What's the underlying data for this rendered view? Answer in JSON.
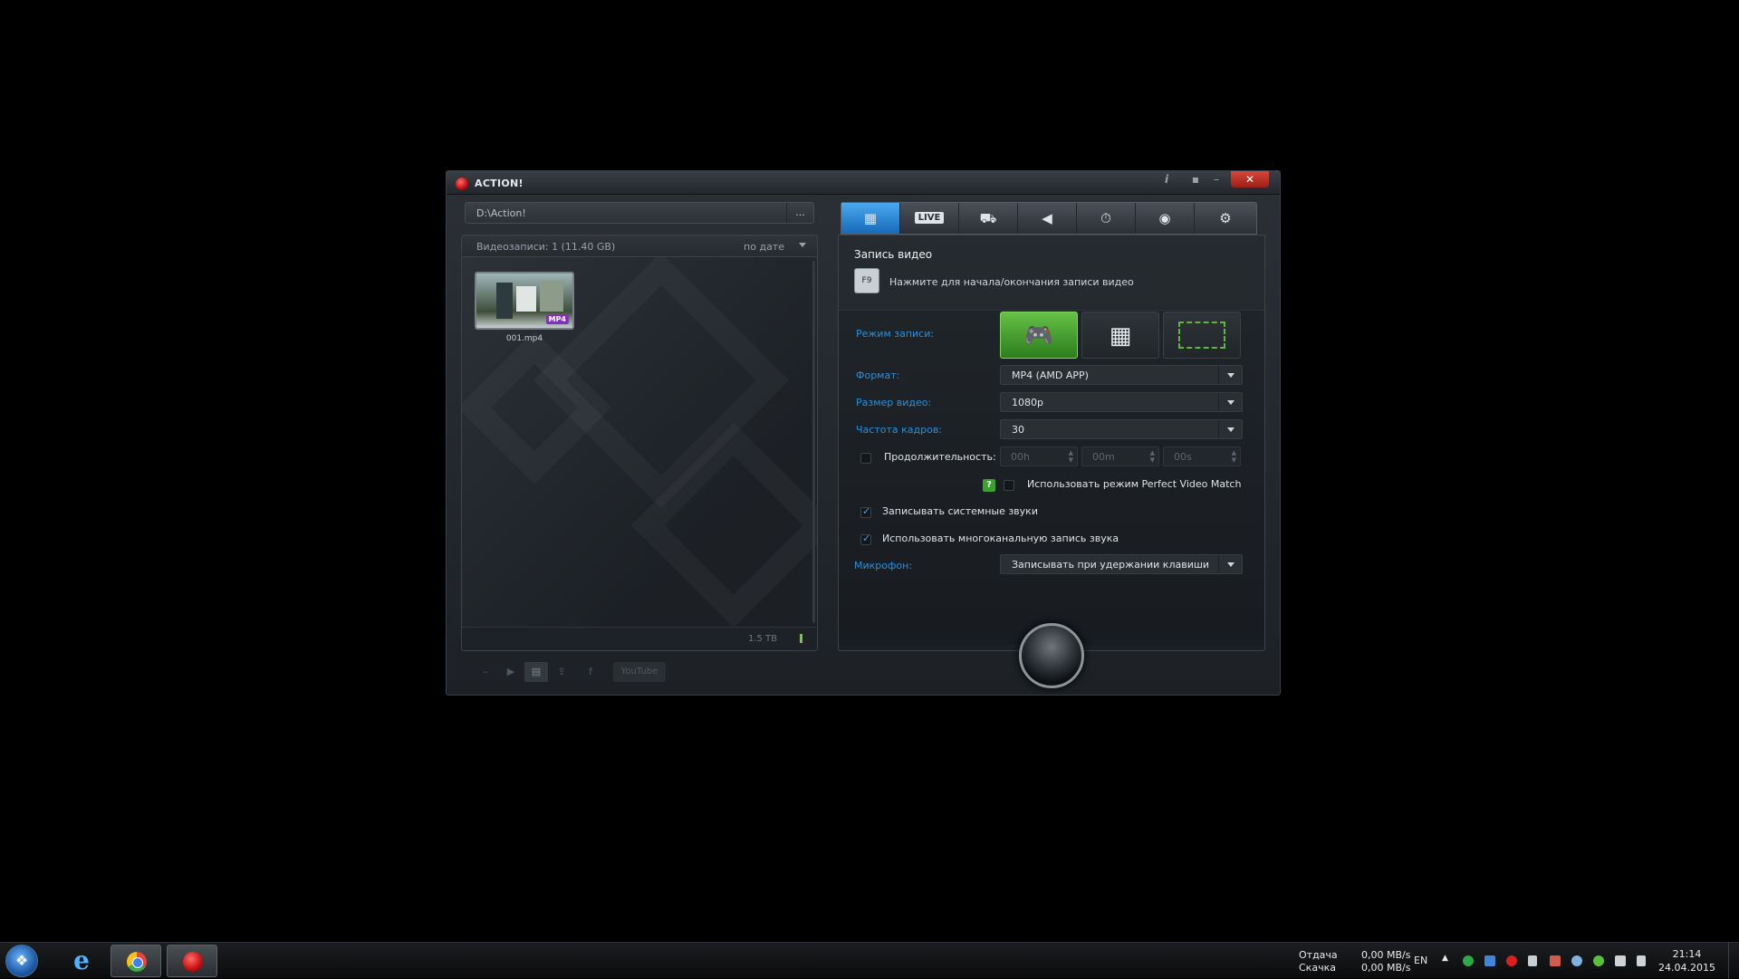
{
  "window": {
    "title": "ACTION!",
    "info_btn": "i",
    "pin_btn": "▪",
    "min_btn": "–",
    "close_btn": "✕"
  },
  "left": {
    "path": "D:\\Action!",
    "path_more": "...",
    "list_count": "Видеозаписи: 1 (11.40 GB)",
    "sort": "по дате",
    "item_badge": "MP4",
    "item_name": "001.mp4",
    "disk_free": "1.5 TB",
    "toolbar": [
      "–",
      "▶",
      "▤",
      "⇪",
      "f"
    ],
    "youtube": "YouTube"
  },
  "tabs": [
    {
      "name": "video",
      "icon": "▦"
    },
    {
      "name": "live",
      "label": "LIVE"
    },
    {
      "name": "benchmark",
      "icon": "⛟"
    },
    {
      "name": "audio",
      "icon": "◀"
    },
    {
      "name": "timer",
      "icon": "⏱"
    },
    {
      "name": "screenshot",
      "icon": "◉"
    },
    {
      "name": "settings",
      "icon": "⚙"
    }
  ],
  "video": {
    "section_title": "Запись видео",
    "hotkey": "F9",
    "hotkey_hint": "Нажмите для начала/окончания записи видео",
    "mode_label": "Режим записи:",
    "modes": [
      "game-mode",
      "desktop-mode",
      "region-mode"
    ],
    "format_label": "Формат:",
    "format_value": "MP4 (AMD APP)",
    "size_label": "Размер видео:",
    "size_value": "1080p",
    "fps_label": "Частота кадров:",
    "fps_value": "30",
    "duration_label": "Продолжительность:",
    "duration_h": "00h",
    "duration_m": "00m",
    "duration_s": "00s",
    "pvm_help": "?",
    "pvm_label": "Использовать режим Perfect Video Match",
    "sys_sound_label": "Записывать системные звуки",
    "multi_sound_label": "Использовать многоканальную запись звука",
    "mic_label": "Микрофон:",
    "mic_value": "Записывать при удержании клавиши",
    "duration_checked": false,
    "pvm_checked": false,
    "sys_sound_checked": true,
    "multi_sound_checked": true
  },
  "taskbar": {
    "upload_label": "Отдача",
    "download_label": "Скачка",
    "upload_value": "0,00 MB/s",
    "download_value": "0,00 MB/s",
    "lang": "EN",
    "time": "21:14",
    "date": "24.04.2015"
  }
}
